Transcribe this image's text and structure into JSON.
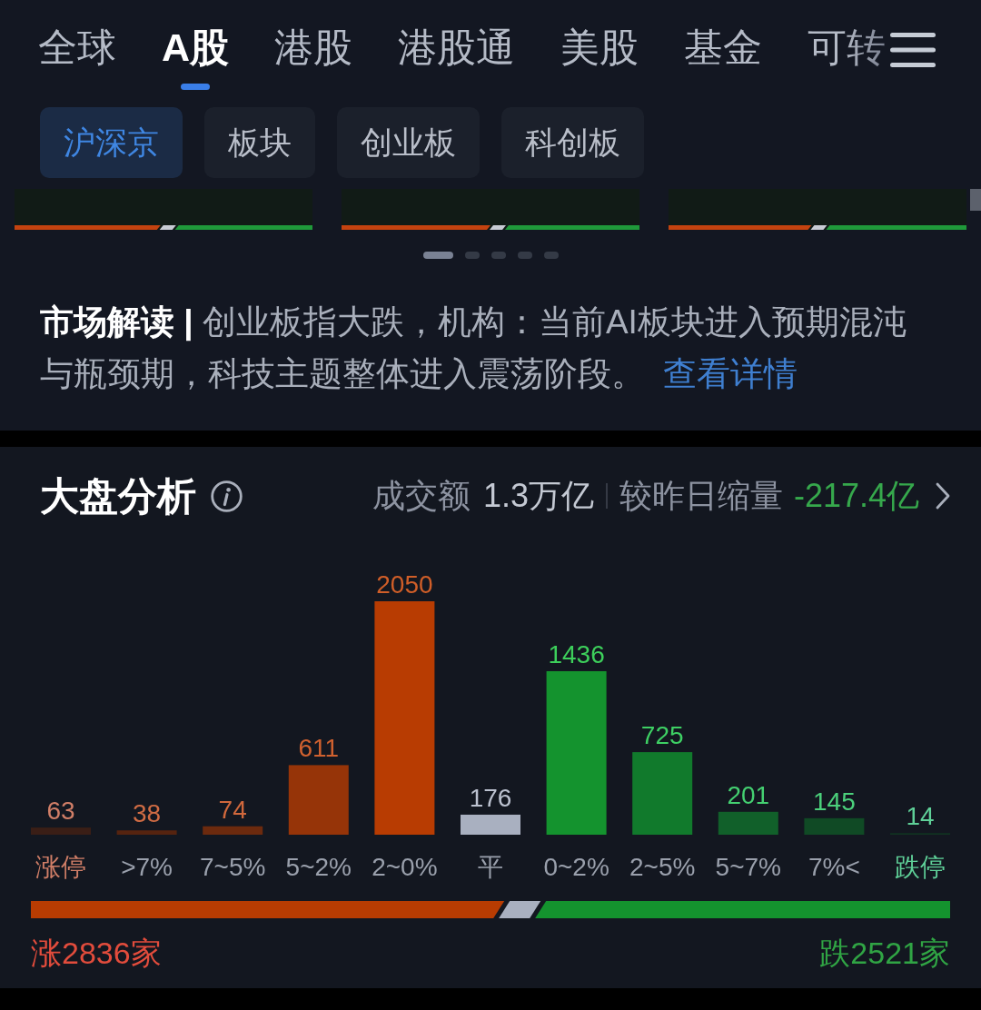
{
  "tabs": [
    {
      "label": "全球",
      "selected": false
    },
    {
      "label": "A股",
      "selected": true
    },
    {
      "label": "港股",
      "selected": false
    },
    {
      "label": "港股通",
      "selected": false
    },
    {
      "label": "美股",
      "selected": false
    },
    {
      "label": "基金",
      "selected": false
    },
    {
      "label": "可转",
      "selected": false
    }
  ],
  "sub_tabs": [
    {
      "label": "沪深京",
      "selected": true
    },
    {
      "label": "板块",
      "selected": false
    },
    {
      "label": "创业板",
      "selected": false
    },
    {
      "label": "科创板",
      "selected": false
    }
  ],
  "index_cards": [
    {
      "level": 0.49
    },
    {
      "level": 0.5
    },
    {
      "level": 0.48
    }
  ],
  "carousel_dots": [
    {
      "selected": true
    },
    {
      "selected": false
    },
    {
      "selected": false
    },
    {
      "selected": false
    },
    {
      "selected": false
    }
  ],
  "commentary": {
    "text": "**市场解读 |** 创业板指大跌，机构：当前AI板块进入预期混沌与瓶颈期，科技主题整体进入震荡阶段。",
    "link": "查看详情"
  },
  "market_analysis": {
    "title": "大盘分析",
    "turnover_label": "成交额",
    "turnover": "1.3万亿",
    "change_label": "较昨日缩量",
    "change": "-217.4亿",
    "chart_data": {
      "type": "bar",
      "categories": [
        "涨停",
        ">7%",
        "7~5%",
        "5~2%",
        "2~0%",
        "平",
        "0~2%",
        "2~5%",
        "5~7%",
        "7%<",
        "跌停"
      ],
      "values": [
        63,
        38,
        74,
        611,
        2050,
        176,
        1436,
        725,
        201,
        145,
        14
      ],
      "data_labels": true
    },
    "bars": [
      {
        "color": "#3a1e16"
      },
      {
        "color": "#55230f"
      },
      {
        "color": "#6c2a0e"
      },
      {
        "color": "#963408"
      },
      {
        "color": "#b83c02"
      },
      {
        "color": "#a9b0c0"
      },
      {
        "color": "#14932e"
      },
      {
        "color": "#117a2c"
      },
      {
        "color": "#11602a"
      },
      {
        "color": "#104a25"
      },
      {
        "color": "#113322"
      }
    ],
    "breadth": {
      "level": 0.515,
      "advance": "涨2836家",
      "decline": "跌2521家"
    }
  }
}
